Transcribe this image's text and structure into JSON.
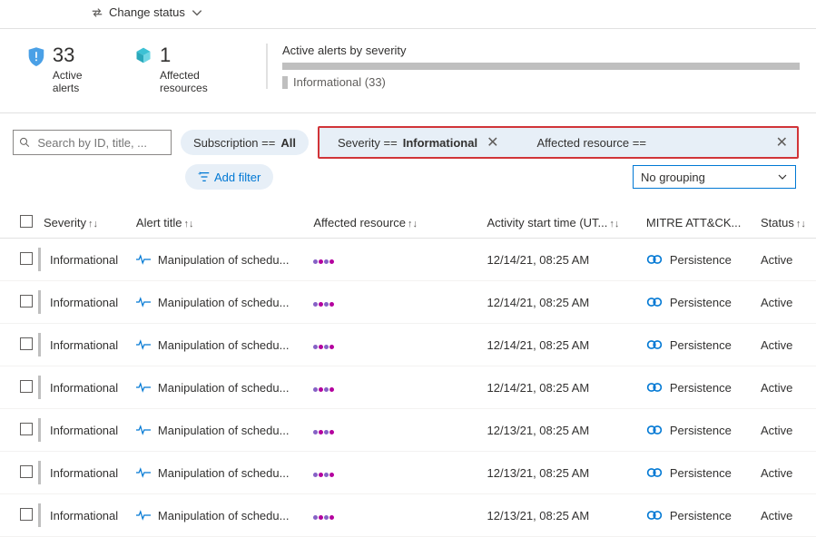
{
  "topAction": {
    "label": "Change status"
  },
  "stats": {
    "activeAlerts": {
      "value": "33",
      "label": "Active alerts"
    },
    "affectedResources": {
      "value": "1",
      "label": "Affected resources"
    },
    "severity": {
      "title": "Active alerts by severity",
      "legend": "Informational (33)"
    }
  },
  "search": {
    "placeholder": "Search by ID, title, ..."
  },
  "filters": {
    "subscription": {
      "key": "Subscription == ",
      "value": "All"
    },
    "severity": {
      "key": "Severity == ",
      "value": "Informational"
    },
    "affected": {
      "key": "Affected resource == ",
      "value": ""
    },
    "addFilter": "Add filter"
  },
  "grouping": {
    "selected": "No grouping"
  },
  "columns": {
    "severity": "Severity",
    "title": "Alert title",
    "resource": "Affected resource",
    "activity": "Activity start time (UT...",
    "mitre": "MITRE ATT&CK...",
    "status": "Status"
  },
  "rows": [
    {
      "severity": "Informational",
      "title": "Manipulation of schedu...",
      "time": "12/14/21, 08:25 AM",
      "mitre": "Persistence",
      "status": "Active"
    },
    {
      "severity": "Informational",
      "title": "Manipulation of schedu...",
      "time": "12/14/21, 08:25 AM",
      "mitre": "Persistence",
      "status": "Active"
    },
    {
      "severity": "Informational",
      "title": "Manipulation of schedu...",
      "time": "12/14/21, 08:25 AM",
      "mitre": "Persistence",
      "status": "Active"
    },
    {
      "severity": "Informational",
      "title": "Manipulation of schedu...",
      "time": "12/14/21, 08:25 AM",
      "mitre": "Persistence",
      "status": "Active"
    },
    {
      "severity": "Informational",
      "title": "Manipulation of schedu...",
      "time": "12/13/21, 08:25 AM",
      "mitre": "Persistence",
      "status": "Active"
    },
    {
      "severity": "Informational",
      "title": "Manipulation of schedu...",
      "time": "12/13/21, 08:25 AM",
      "mitre": "Persistence",
      "status": "Active"
    },
    {
      "severity": "Informational",
      "title": "Manipulation of schedu...",
      "time": "12/13/21, 08:25 AM",
      "mitre": "Persistence",
      "status": "Active"
    }
  ]
}
